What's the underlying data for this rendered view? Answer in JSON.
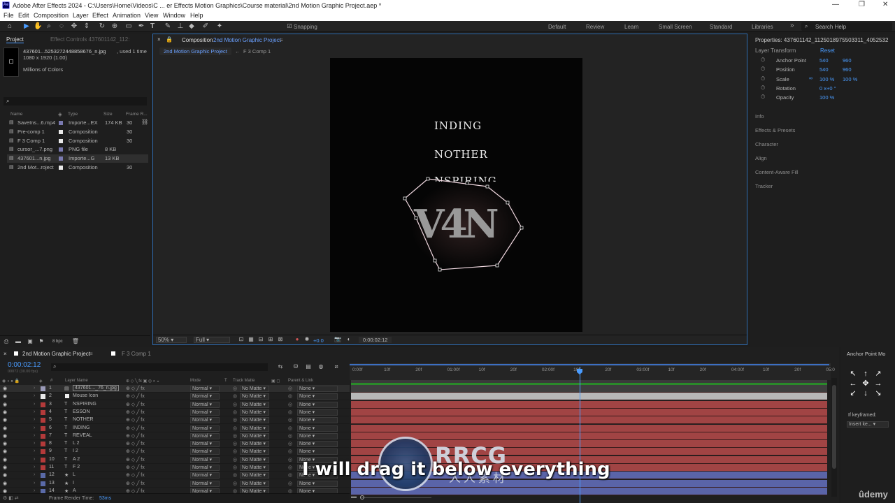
{
  "titlebar": {
    "title": "Adobe After Effects 2024 - C:\\Users\\Home\\Videos\\C ... er Effects Motion Graphics\\Course material\\2nd Motion Graphic Project.aep *"
  },
  "menu": [
    "File",
    "Edit",
    "Composition",
    "Layer",
    "Effect",
    "Animation",
    "View",
    "Window",
    "Help"
  ],
  "toolbar": {
    "snapping": "Snapping",
    "workspaces": [
      "Default",
      "Review",
      "Learn",
      "Small Screen",
      "Standard",
      "Libraries"
    ],
    "search": "Search Help"
  },
  "project": {
    "tab": "Project",
    "tab2": "Effect Controls 437601142_112:",
    "selected_name": "437601...5253272448858676_n.jpg",
    "used": ", used 1 time",
    "dims": "1080 x 1920 (1.00)",
    "colors": "Millions of Colors",
    "headers": {
      "name": "Name",
      "type": "Type",
      "size": "Size",
      "frame": "Frame R..."
    },
    "items": [
      {
        "name": "SaveIns...6.mp4",
        "type": "Importe...EX",
        "size": "174 KB",
        "frame": "30",
        "color": "#7a7ab0"
      },
      {
        "name": "Pre-comp 1",
        "type": "Composition",
        "size": "",
        "frame": "30",
        "color": "#e8e8e8"
      },
      {
        "name": "F 3 Comp 1",
        "type": "Composition",
        "size": "",
        "frame": "30",
        "color": "#e8e8e8"
      },
      {
        "name": "cursor_...7.png",
        "type": "PNG file",
        "size": "8 KB",
        "frame": "",
        "color": "#7a7ab0"
      },
      {
        "name": "437601...n.jpg",
        "type": "Importe...G",
        "size": "13 KB",
        "frame": "",
        "color": "#7a7ab0"
      },
      {
        "name": "2nd Mot...roject",
        "type": "Composition",
        "size": "",
        "frame": "30",
        "color": "#e8e8e8"
      }
    ],
    "bpc": "8 bpc"
  },
  "comp": {
    "tab_prefix": "Composition",
    "tab_name": "2nd Motion Graphic Project",
    "crumb1": "2nd Motion Graphic Project",
    "crumb2": "F 3 Comp 1",
    "zoom": "50%",
    "quality": "Full",
    "exposure": "+0.0",
    "time": "0:00:02:12",
    "canvas_lines": [
      "INDING",
      "NOTHER",
      "NSPIRING"
    ],
    "logo": "V4N"
  },
  "properties": {
    "title": "Properties: 437601142_1125018975503311_4052532",
    "section": "Layer Transform",
    "reset": "Reset",
    "rows": [
      {
        "name": "Anchor Point",
        "v1": "540",
        "v2": "960"
      },
      {
        "name": "Position",
        "v1": "540",
        "v2": "960"
      },
      {
        "name": "Scale",
        "v1": "100 %",
        "v2": "100 %"
      },
      {
        "name": "Rotation",
        "v1": "0 x+0 °",
        "v2": ""
      },
      {
        "name": "Opacity",
        "v1": "100 %",
        "v2": ""
      }
    ],
    "panels": [
      "Info",
      "Effects & Presets",
      "Character",
      "Align",
      "Content-Aware Fill",
      "Tracker"
    ]
  },
  "timeline": {
    "tab": "2nd Motion Graphic Project",
    "tab2": "F 3 Comp 1",
    "timecode": "0:00:02:12",
    "frames": "00072 (30.00 fps)",
    "headers": {
      "num": "#",
      "name": "Layer Name",
      "mode": "Mode",
      "t": "T",
      "matte": "Track Matte",
      "parent": "Parent & Link"
    },
    "ticks": [
      "0:00f",
      "10f",
      "20f",
      "01:00f",
      "10f",
      "20f",
      "02:00f",
      "10f",
      "20f",
      "03:00f",
      "10f",
      "20f",
      "04:00f",
      "10f",
      "20f",
      "05:0"
    ],
    "layers": [
      {
        "n": "1",
        "kind": "img",
        "name": "437601..._76_n.jpg",
        "color": "#9a9ab8",
        "mode": "Normal",
        "matte": "No Matte",
        "parent": "None",
        "sel": true
      },
      {
        "n": "2",
        "kind": "sq",
        "name": "Mouse Icon",
        "color": "#e8e8e8",
        "mode": "Normal",
        "matte": "No Matte",
        "parent": "None"
      },
      {
        "n": "3",
        "kind": "T",
        "name": "NSPIRING",
        "color": "#b33a3a",
        "mode": "Normal",
        "matte": "No Matte",
        "parent": "None"
      },
      {
        "n": "4",
        "kind": "T",
        "name": "ESSON",
        "color": "#b33a3a",
        "mode": "Normal",
        "matte": "No Matte",
        "parent": "None"
      },
      {
        "n": "5",
        "kind": "T",
        "name": "NOTHER",
        "color": "#b33a3a",
        "mode": "Normal",
        "matte": "No Matte",
        "parent": "None"
      },
      {
        "n": "6",
        "kind": "T",
        "name": "INDING",
        "color": "#b33a3a",
        "mode": "Normal",
        "matte": "No Matte",
        "parent": "None"
      },
      {
        "n": "7",
        "kind": "T",
        "name": "REVEAL",
        "color": "#b33a3a",
        "mode": "Normal",
        "matte": "No Matte",
        "parent": "None"
      },
      {
        "n": "8",
        "kind": "T",
        "name": "L 2",
        "color": "#b33a3a",
        "mode": "Normal",
        "matte": "No Matte",
        "parent": "None"
      },
      {
        "n": "9",
        "kind": "T",
        "name": "I 2",
        "color": "#b33a3a",
        "mode": "Normal",
        "matte": "No Matte",
        "parent": "None"
      },
      {
        "n": "10",
        "kind": "T",
        "name": "A 2",
        "color": "#b33a3a",
        "mode": "Normal",
        "matte": "No Matte",
        "parent": "None"
      },
      {
        "n": "11",
        "kind": "T",
        "name": "F 2",
        "color": "#b33a3a",
        "mode": "Normal",
        "matte": "No Matte",
        "parent": "None"
      },
      {
        "n": "12",
        "kind": "★",
        "name": "L",
        "color": "#5a6aa8",
        "mode": "Normal",
        "matte": "No Matte",
        "parent": "None"
      },
      {
        "n": "13",
        "kind": "★",
        "name": "I",
        "color": "#5a6aa8",
        "mode": "Normal",
        "matte": "No Matte",
        "parent": "None"
      },
      {
        "n": "14",
        "kind": "★",
        "name": "A",
        "color": "#5a6aa8",
        "mode": "Normal",
        "matte": "No Matte",
        "parent": "None"
      }
    ],
    "render_label": "Frame Render Time:",
    "render_time": "53ms"
  },
  "anchor_panel": {
    "title": "Anchor Point Mo",
    "if_key": "If keyframed:",
    "insert": "Insert ke..."
  },
  "subtitle": "I will drag it below everything",
  "watermark": {
    "text": "RRCG",
    "sub": "人人素材"
  },
  "udemy": "ûdemy"
}
